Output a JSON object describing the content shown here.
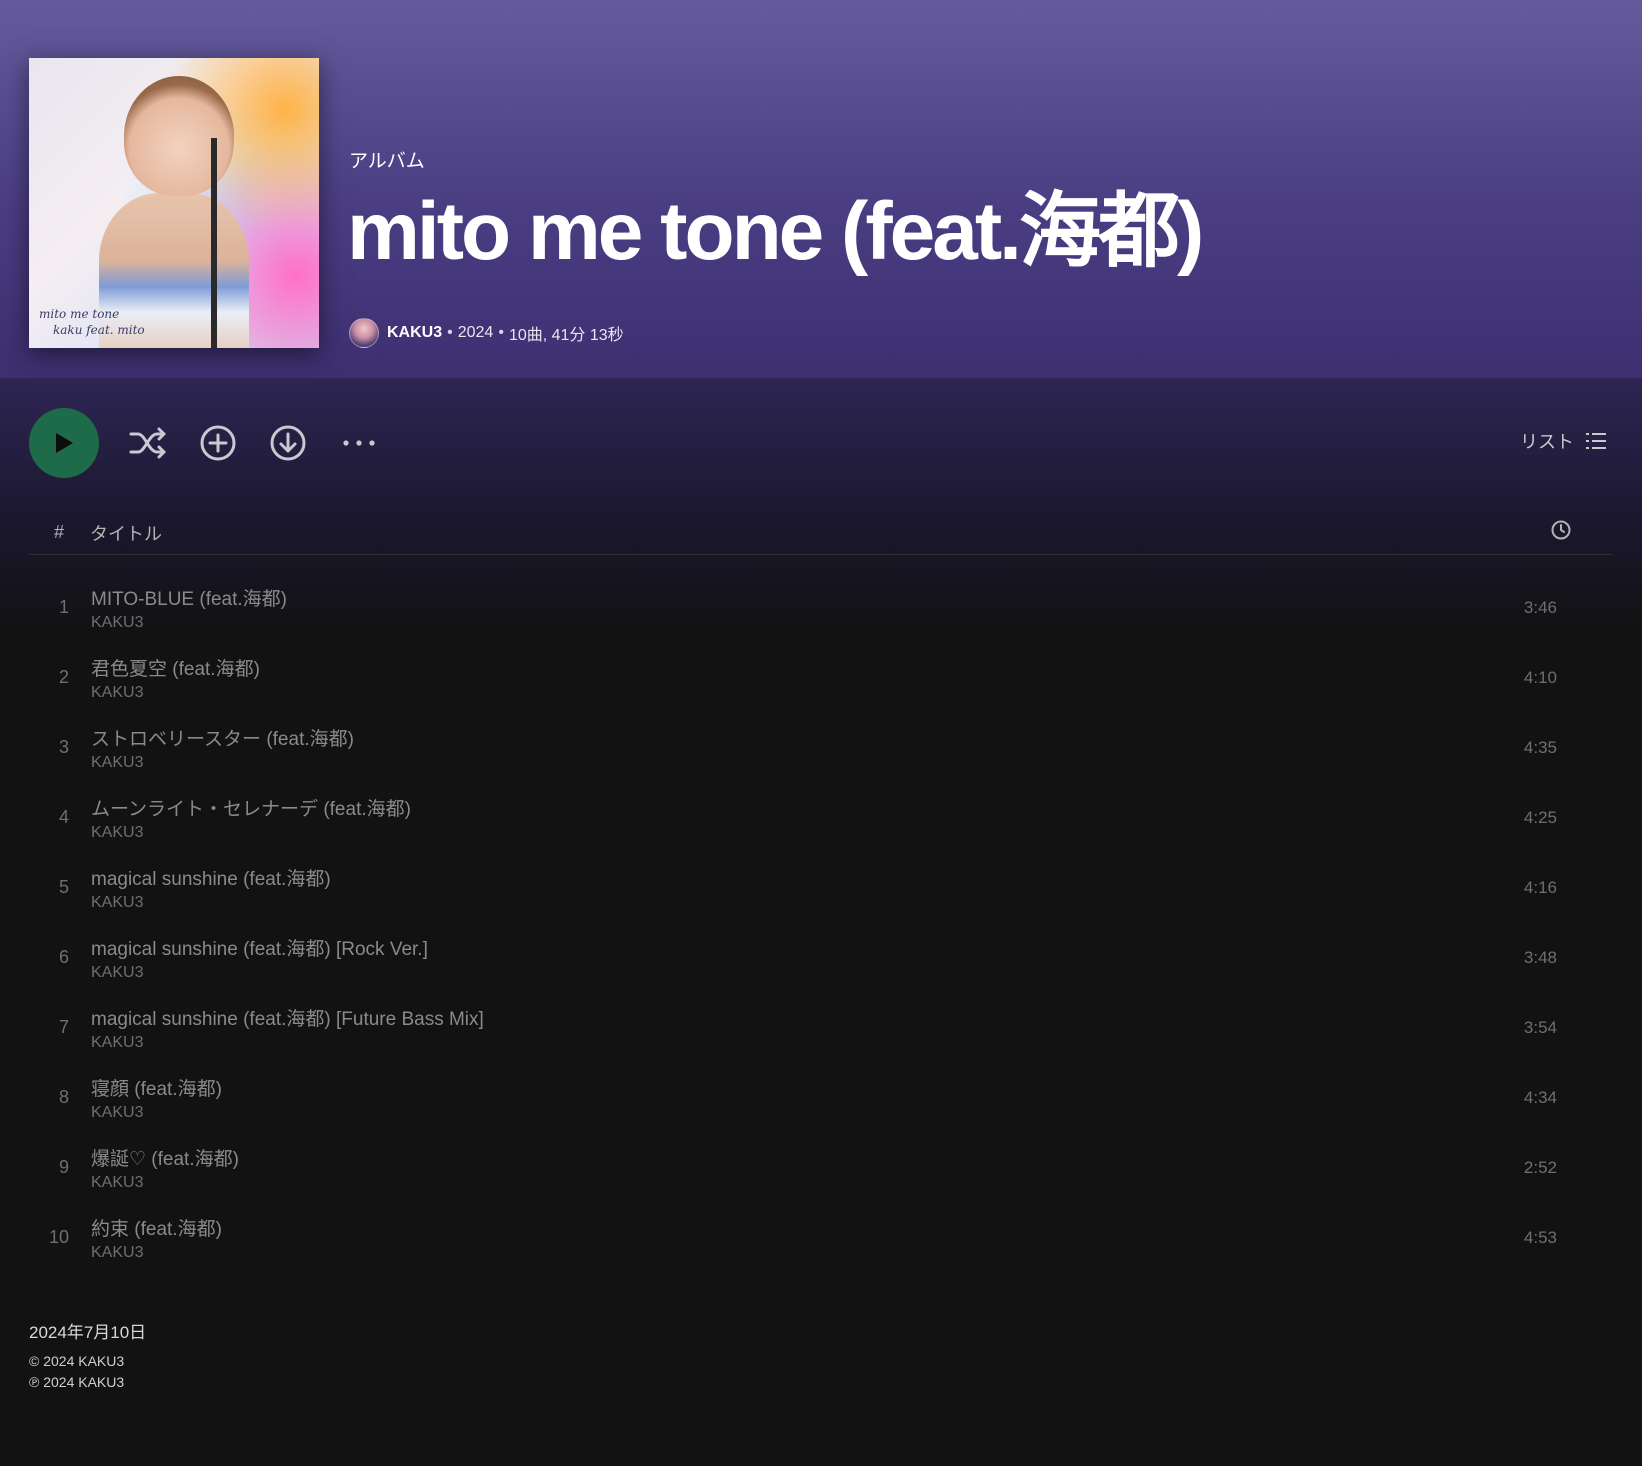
{
  "album": {
    "type_label": "アルバム",
    "title": "mito me tone (feat.海都)",
    "artist": "KAKU3",
    "year": "2024",
    "summary": "10曲, 41分 13秒",
    "cover_text_line1": "mito me tone",
    "cover_text_line2": "kaku feat. mito"
  },
  "actions": {
    "list_view_label": "リスト"
  },
  "table": {
    "num_header": "#",
    "title_header": "タイトル"
  },
  "tracks": [
    {
      "num": "1",
      "title": "MITO-BLUE (feat.海都)",
      "artist": "KAKU3",
      "duration": "3:46"
    },
    {
      "num": "2",
      "title": "君色夏空 (feat.海都)",
      "artist": "KAKU3",
      "duration": "4:10"
    },
    {
      "num": "3",
      "title": "ストロベリースター (feat.海都)",
      "artist": "KAKU3",
      "duration": "4:35"
    },
    {
      "num": "4",
      "title": "ムーンライト・セレナーデ (feat.海都)",
      "artist": "KAKU3",
      "duration": "4:25"
    },
    {
      "num": "5",
      "title": "magical sunshine (feat.海都)",
      "artist": "KAKU3",
      "duration": "4:16"
    },
    {
      "num": "6",
      "title": "magical sunshine (feat.海都) [Rock Ver.]",
      "artist": "KAKU3",
      "duration": "3:48"
    },
    {
      "num": "7",
      "title": "magical sunshine (feat.海都) [Future Bass Mix]",
      "artist": "KAKU3",
      "duration": "3:54"
    },
    {
      "num": "8",
      "title": "寝顔 (feat.海都)",
      "artist": "KAKU3",
      "duration": "4:34"
    },
    {
      "num": "9",
      "title": "爆誕♡ (feat.海都)",
      "artist": "KAKU3",
      "duration": "2:52"
    },
    {
      "num": "10",
      "title": "約束 (feat.海都)",
      "artist": "KAKU3",
      "duration": "4:53"
    }
  ],
  "footer": {
    "release_date": "2024年7月10日",
    "copyright": "© 2024 KAKU3",
    "phonogram": "℗ 2024 KAKU3"
  },
  "colors": {
    "header_top": "#655b9c",
    "header_bottom": "#3d2f70",
    "play_button": "#1d6b49",
    "background": "#121212"
  },
  "icons": [
    "play-icon",
    "shuffle-icon",
    "add-circle-icon",
    "download-icon",
    "more-icon",
    "list-icon",
    "clock-icon"
  ]
}
